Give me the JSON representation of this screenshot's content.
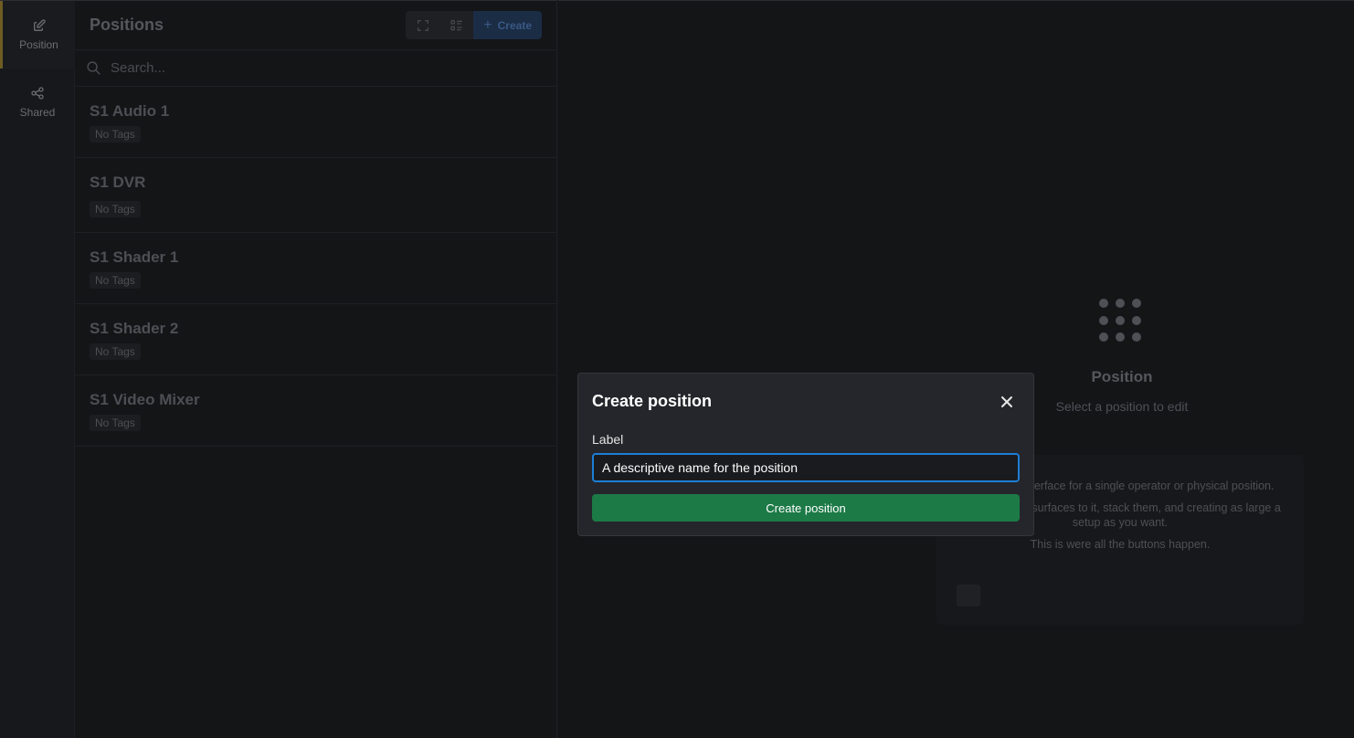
{
  "nav": {
    "items": [
      {
        "label": "Position",
        "icon": "edit-icon",
        "active": true
      },
      {
        "label": "Shared",
        "icon": "share-icon",
        "active": false
      }
    ]
  },
  "panel": {
    "title": "Positions",
    "create_label": "Create",
    "search_placeholder": "Search...",
    "items": [
      {
        "name": "S1 Audio 1",
        "tag": "No Tags"
      },
      {
        "name": "S1 DVR",
        "tag": "No Tags"
      },
      {
        "name": "S1 Shader 1",
        "tag": "No Tags"
      },
      {
        "name": "S1 Shader 2",
        "tag": "No Tags"
      },
      {
        "name": "S1 Video Mixer",
        "tag": "No Tags"
      }
    ]
  },
  "empty_state": {
    "title": "Position",
    "subtitle": "Select a position to edit",
    "info_line1": "is the user interface for a single operator or physical position.",
    "info_line2": "ssign multiple surfaces to it, stack them, and creating as large a setup as you want.",
    "info_line3": "This is were all the buttons happen."
  },
  "modal": {
    "title": "Create position",
    "label": "Label",
    "input_value": "A descriptive name for the position",
    "submit_label": "Create position"
  },
  "colors": {
    "accent_blue": "#1c7ed6",
    "submit_green": "#1c7a47",
    "active_rail": "#6e5c23"
  }
}
